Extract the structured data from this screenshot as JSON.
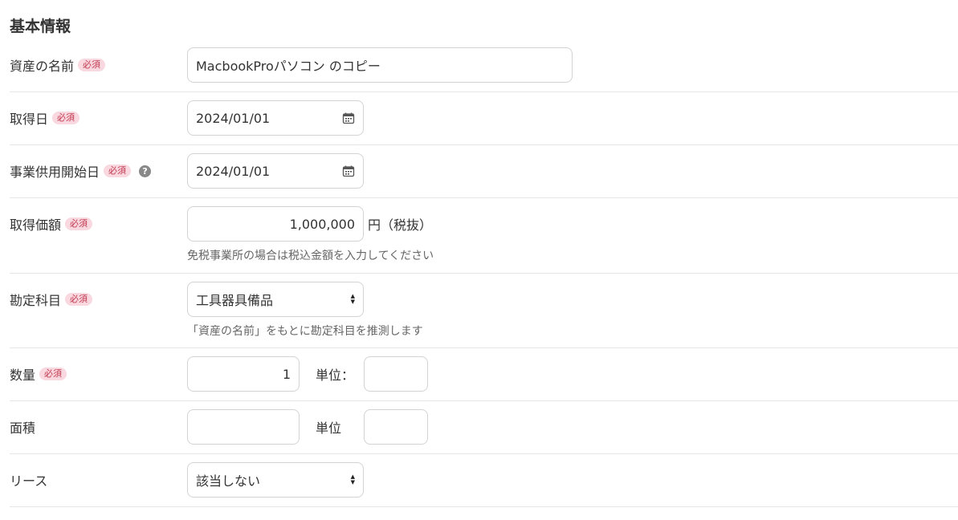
{
  "section": {
    "title": "基本情報"
  },
  "required_badge": "必須",
  "help_icon_glyph": "?",
  "colors": {
    "badge_bg": "#f9d8df",
    "badge_text": "#c23a52",
    "border": "#d3d3d3",
    "divider": "#e6e6e6"
  },
  "fields": {
    "asset_name": {
      "label": "資産の名前",
      "value": "MacbookProパソコン のコピー"
    },
    "acquisition_date": {
      "label": "取得日",
      "value": "2024/01/01",
      "icon": "calendar-icon"
    },
    "service_start_date": {
      "label": "事業供用開始日",
      "value": "2024/01/01",
      "icon": "calendar-icon"
    },
    "acquisition_price": {
      "label": "取得価額",
      "value": "1,000,000",
      "suffix": "円（税抜）",
      "hint": "免税事業所の場合は税込金額を入力してください"
    },
    "account_item": {
      "label": "勘定科目",
      "value": "工具器具備品",
      "hint": "「資産の名前」をもとに勘定科目を推測します"
    },
    "quantity": {
      "label": "数量",
      "value": "1",
      "unit_label": "単位：",
      "unit_value": ""
    },
    "area": {
      "label": "面積",
      "value": "",
      "unit_label": "単位",
      "unit_value": ""
    },
    "lease": {
      "label": "リース",
      "value": "該当しない"
    }
  }
}
